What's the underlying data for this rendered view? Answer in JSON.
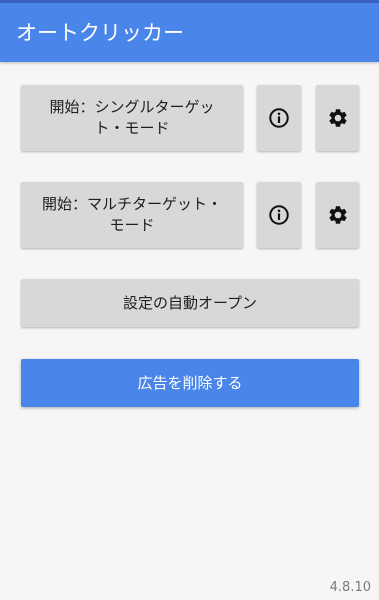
{
  "app": {
    "title": "オートクリッカー"
  },
  "buttons": {
    "single_target_label": "開始：シングルターゲット・モード",
    "multi_target_label": "開始：マルチターゲット・モード",
    "auto_open_settings_label": "設定の自動オープン",
    "remove_ads_label": "広告を削除する"
  },
  "icons": {
    "info": "info-icon",
    "settings": "gear-icon"
  },
  "footer": {
    "version": "4.8.10"
  },
  "colors": {
    "app_bar": "#4a86ea",
    "primary_button": "#4a86ea",
    "secondary_button": "#d8d8d8",
    "background": "#f6f6f6"
  }
}
